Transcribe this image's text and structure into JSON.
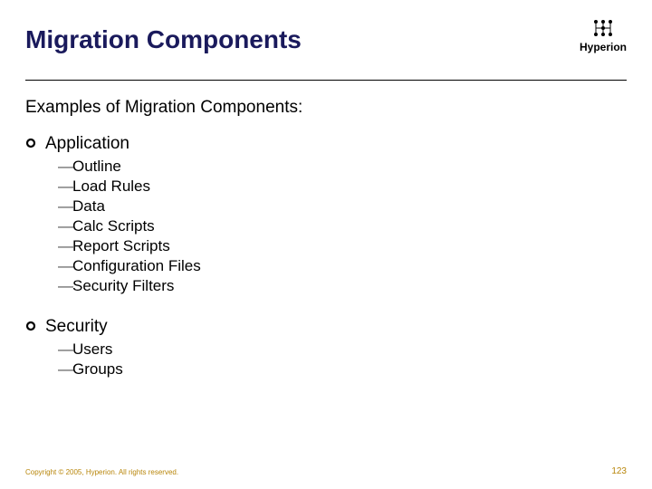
{
  "title": "Migration Components",
  "logo_text": "Hyperion",
  "intro": "Examples of Migration Components:",
  "sections": [
    {
      "heading": "Application",
      "items": [
        "Outline",
        "Load Rules",
        "Data",
        "Calc Scripts",
        "Report Scripts",
        "Configuration Files",
        "Security Filters"
      ]
    },
    {
      "heading": "Security",
      "items": [
        "Users",
        "Groups"
      ]
    }
  ],
  "footer": {
    "copyright": "Copyright © 2005, Hyperion. All rights reserved.",
    "page": "123"
  }
}
